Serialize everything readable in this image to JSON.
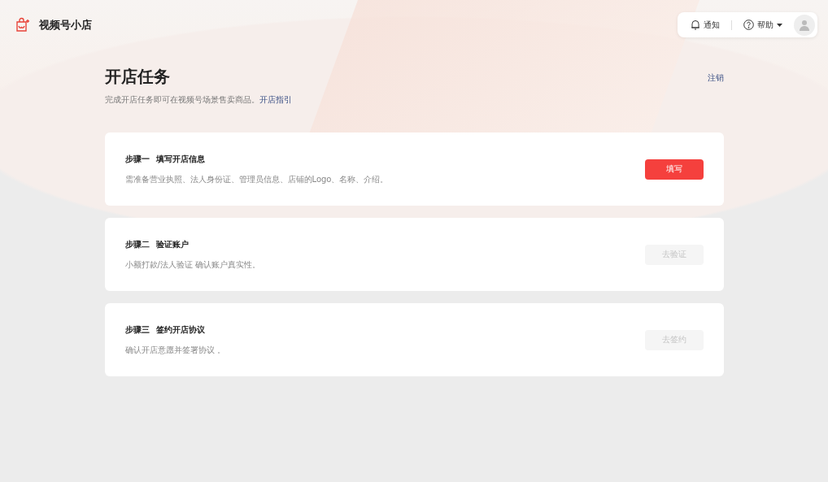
{
  "header": {
    "brand": "视频号小店",
    "notifications": "通知",
    "help": "帮助"
  },
  "page": {
    "title": "开店任务",
    "subtitle": "完成开店任务即可在视频号场景售卖商品。",
    "guide_link": "开店指引",
    "logout": "注销"
  },
  "steps": [
    {
      "step": "步骤一",
      "title": "填写开店信息",
      "description": "需准备营业执照、法人身份证、管理员信息、店铺的Logo、名称、介绍。",
      "button": {
        "label": "填写",
        "disabled": false
      }
    },
    {
      "step": "步骤二",
      "title": "验证账户",
      "description": "小额打款/法人验证 确认账户真实性。",
      "button": {
        "label": "去验证",
        "disabled": true
      }
    },
    {
      "step": "步骤三",
      "title": "签约开店协议",
      "description": "确认开店意愿并签署协议 。",
      "button": {
        "label": "去签约",
        "disabled": true
      }
    }
  ]
}
